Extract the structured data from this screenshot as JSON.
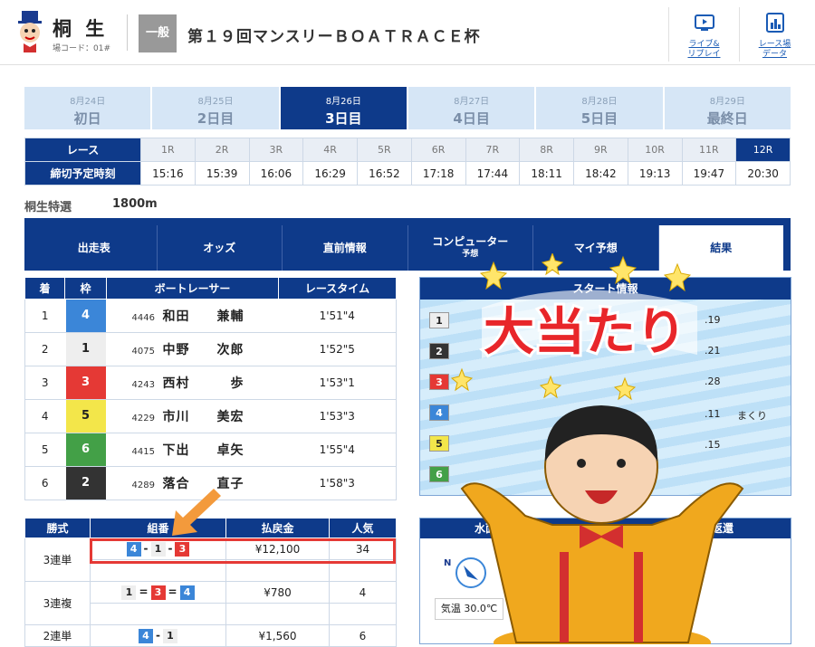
{
  "header": {
    "venue": "桐 生",
    "venue_code": "場コード：01#",
    "grade": "一般",
    "race_title": "第１９回マンスリーＢＯＡＴＲＡＣＥ杯",
    "live_label_1": "ライブ&",
    "live_label_2": "リプレイ",
    "data_label_1": "レース場",
    "data_label_2": "データ"
  },
  "days": [
    {
      "date": "8月24日",
      "label": "初日"
    },
    {
      "date": "8月25日",
      "label": "2日目"
    },
    {
      "date": "8月26日",
      "label": "3日目"
    },
    {
      "date": "8月27日",
      "label": "4日目"
    },
    {
      "date": "8月28日",
      "label": "5日目"
    },
    {
      "date": "8月29日",
      "label": "最終日"
    }
  ],
  "race_table": {
    "race_label": "レース",
    "deadline_label": "締切予定時刻",
    "races": [
      "1R",
      "2R",
      "3R",
      "4R",
      "5R",
      "6R",
      "7R",
      "8R",
      "9R",
      "10R",
      "11R",
      "12R"
    ],
    "times": [
      "15:16",
      "15:39",
      "16:06",
      "16:29",
      "16:52",
      "17:18",
      "17:44",
      "18:11",
      "18:42",
      "19:13",
      "19:47",
      "20:30"
    ]
  },
  "race_info": {
    "name": "桐生特選",
    "distance": "1800m"
  },
  "tabs": [
    {
      "label": "出走表",
      "sub": ""
    },
    {
      "label": "オッズ",
      "sub": ""
    },
    {
      "label": "直前情報",
      "sub": ""
    },
    {
      "label": "コンピューター",
      "sub": "予想"
    },
    {
      "label": "マイ予想",
      "sub": ""
    },
    {
      "label": "結果",
      "sub": ""
    }
  ],
  "results": {
    "headers": [
      "着",
      "枠",
      "ボートレーサー",
      "レースタイム"
    ],
    "rows": [
      {
        "place": "1",
        "frame": "4",
        "id": "4446",
        "name": "和田　　兼輔",
        "time": "1'51\"4"
      },
      {
        "place": "2",
        "frame": "1",
        "id": "4075",
        "name": "中野　　次郎",
        "time": "1'52\"5"
      },
      {
        "place": "3",
        "frame": "3",
        "id": "4243",
        "name": "西村　　　歩",
        "time": "1'53\"1"
      },
      {
        "place": "4",
        "frame": "5",
        "id": "4229",
        "name": "市川　　美宏",
        "time": "1'53\"3"
      },
      {
        "place": "5",
        "frame": "6",
        "id": "4415",
        "name": "下出　　卓矢",
        "time": "1'55\"4"
      },
      {
        "place": "6",
        "frame": "2",
        "id": "4289",
        "name": "落合　　直子",
        "time": "1'58\"3"
      }
    ]
  },
  "start_info": {
    "title": "スタート情報",
    "rows": [
      {
        "frame": "1",
        "time": ".19",
        "kimarite": ""
      },
      {
        "frame": "2",
        "time": ".21",
        "kimarite": ""
      },
      {
        "frame": "3",
        "time": ".28",
        "kimarite": ""
      },
      {
        "frame": "4",
        "time": ".11",
        "kimarite": "まくり"
      },
      {
        "frame": "5",
        "time": ".15",
        "kimarite": ""
      },
      {
        "frame": "6",
        "time": "",
        "kimarite": ""
      }
    ]
  },
  "payout": {
    "headers": [
      "勝式",
      "組番",
      "払戻金",
      "人気"
    ],
    "rows": [
      {
        "type": "3連単",
        "combo": [
          "4",
          "1",
          "3"
        ],
        "sep": [
          "-",
          "-"
        ],
        "amount": "¥12,100",
        "pop": "34"
      },
      {
        "type": "3連複",
        "combo": [
          "1",
          "3",
          "4"
        ],
        "sep": [
          "=",
          "="
        ],
        "amount": "¥780",
        "pop": "4"
      },
      {
        "type": "2連単",
        "combo": [
          "4",
          "1"
        ],
        "sep": [
          "-"
        ],
        "amount": "¥1,560",
        "pop": "6"
      }
    ]
  },
  "weather": {
    "title": "水面気象情報",
    "wave_label": "返還",
    "temp_label": "気温 30.0℃",
    "compass": "N"
  },
  "overlay": {
    "banner": "大当たり"
  },
  "colors": {
    "navy": "#0e3a8a",
    "highlight": "#e53935",
    "arrow": "#f39a3c"
  }
}
